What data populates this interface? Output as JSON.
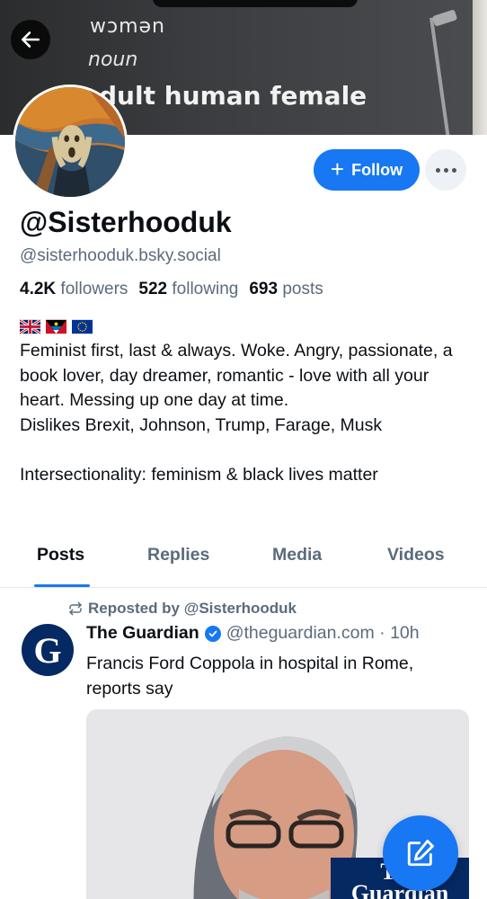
{
  "banner": {
    "word": "wᴐmən",
    "pos": "noun",
    "definition": "dult human female"
  },
  "profile": {
    "display_name": "@Sisterhooduk",
    "handle": "@sisterhooduk.bsky.social",
    "stats": [
      {
        "value": "4.2K",
        "label": "followers"
      },
      {
        "value": "522",
        "label": "following"
      },
      {
        "value": "693",
        "label": "posts"
      }
    ],
    "flags": [
      "uk-flag",
      "antigua-barbuda-flag",
      "eu-flag"
    ],
    "bio": "Feminist first, last & always. Woke. Angry, passionate, a book lover, day dreamer, romantic - love with all your heart. Messing up one day at time.\nDislikes Brexit, Johnson, Trump, Farage, Musk\n\nIntersectionality: feminism & black lives matter"
  },
  "actions": {
    "follow_label": "Follow",
    "follow_plus": "+"
  },
  "tabs": [
    {
      "label": "Posts",
      "active": true
    },
    {
      "label": "Replies",
      "active": false
    },
    {
      "label": "Media",
      "active": false
    },
    {
      "label": "Videos",
      "active": false
    }
  ],
  "post": {
    "repost_label": "Reposted by @Sisterhooduk",
    "avatar_letter": "G",
    "author": "The Guardian",
    "meta": "@theguardian.com · 10h",
    "text": "Francis Ford Coppola in hospital in Rome, reports say",
    "image_badge": "The Guardian"
  },
  "colors": {
    "accent": "#1877f2",
    "muted_text": "#5b6b7c",
    "guardian_blue": "#052962"
  }
}
